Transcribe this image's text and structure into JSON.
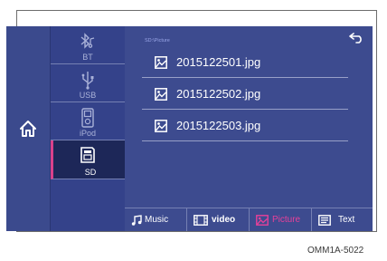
{
  "sources": [
    {
      "label": "BT",
      "icon": "bluetooth-music-icon"
    },
    {
      "label": "USB",
      "icon": "usb-icon"
    },
    {
      "label": "iPod",
      "icon": "ipod-icon"
    },
    {
      "label": "SD",
      "icon": "sd-card-icon",
      "selected": true
    }
  ],
  "breadcrumb": "SD:\\Picture",
  "files": [
    {
      "name": "2015122501.jpg",
      "icon": "image-file-icon"
    },
    {
      "name": "2015122502.jpg",
      "icon": "image-file-icon"
    },
    {
      "name": "2015122503.jpg",
      "icon": "image-file-icon"
    }
  ],
  "tabs": [
    {
      "label": "Music",
      "icon": "music-note-icon"
    },
    {
      "label": "video",
      "icon": "film-icon"
    },
    {
      "label": "Picture",
      "icon": "picture-icon",
      "active": true
    },
    {
      "label": "Text",
      "icon": "text-document-icon"
    }
  ],
  "caption": "OMM1A-5022",
  "colors": {
    "background": "#3c4a8c",
    "accent": "#e8409a",
    "text": "#ffffff"
  }
}
